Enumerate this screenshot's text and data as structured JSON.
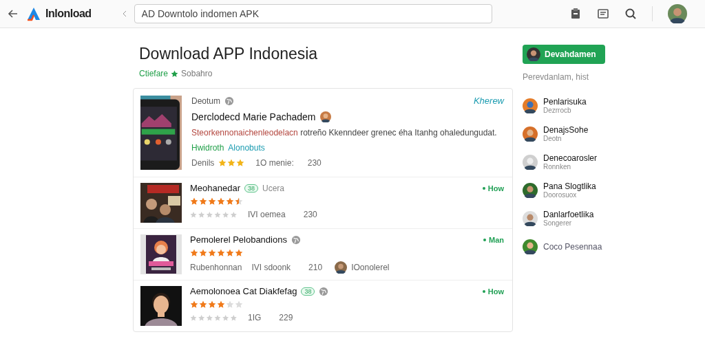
{
  "topbar": {
    "app_name": "Inlonload",
    "search": {
      "value": "AD Downtolo indomen APK"
    }
  },
  "header": {
    "title": "Download APP Indonesia",
    "category": "Ctiefare",
    "rating_label": "Sobahro"
  },
  "download_button": "Devahdamen",
  "featured": {
    "source": "Deotum",
    "link": "Kherew",
    "title": "Derclodecd Marie Pachadem",
    "description_highlight": "Steorkennonaichenleodelacn",
    "description": "rotreño Kkenndeer grenec éha Itanhg ohaledungudat.",
    "developer": "Hwidroth",
    "category": "Alonobuts",
    "meta_label": "Denils",
    "stars": 3,
    "count": "1O menie:",
    "size": "230"
  },
  "items": [
    {
      "title": "Meohanedar",
      "badge": "38",
      "tag": "Ucera",
      "globe": false,
      "stars": 5.5,
      "meta": "IVI oemea",
      "size": "230",
      "action": "How"
    },
    {
      "title": "Pemolerel Pelobandions",
      "globe": true,
      "stars": 6,
      "author": "Rubenhonnan",
      "meta": "IVI sdoonk",
      "size": "210",
      "uploader": "IOonolerel",
      "action": "Man"
    },
    {
      "title": "Aemolonoea Cat Diakfefag",
      "badge": "38",
      "globe": true,
      "stars": 4,
      "meta": "1IG",
      "size": "229",
      "action": "How"
    }
  ],
  "sidebar": {
    "heading": "Perevdanlam, hist",
    "people": [
      {
        "name": "Penlarisuka",
        "detail": "Dezrrocb"
      },
      {
        "name": "DenajsSohe",
        "detail": "Deotn"
      },
      {
        "name": "Denecoarosler",
        "detail": "Ronnken"
      },
      {
        "name": "Pana Slogtlika",
        "detail": "Doorosuox"
      },
      {
        "name": "Danlarfoetlika",
        "detail": "Songerer"
      },
      {
        "name": "Coco Pesennaa"
      }
    ]
  }
}
